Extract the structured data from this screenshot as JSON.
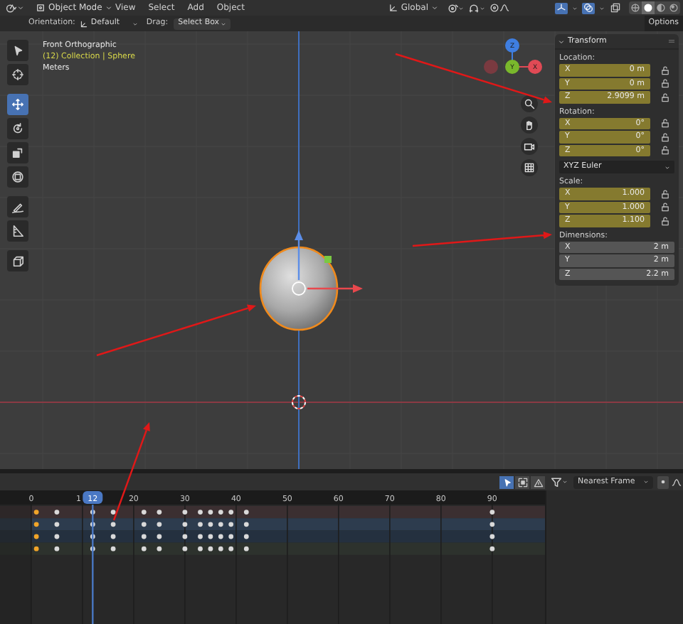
{
  "header": {
    "mode": "Object Mode",
    "menus": [
      "View",
      "Select",
      "Add",
      "Object"
    ],
    "orientation": "Global",
    "toggles": [
      {
        "kind": "gizmo",
        "on": true
      },
      {
        "kind": "overlay",
        "on": true
      },
      {
        "kind": "xray",
        "on": false
      }
    ],
    "shading": [
      {
        "kind": "wireframe",
        "selected": false
      },
      {
        "kind": "solid",
        "selected": true
      },
      {
        "kind": "material",
        "selected": false
      },
      {
        "kind": "rendered",
        "selected": false
      }
    ]
  },
  "tool_settings": {
    "orientation_label": "Orientation:",
    "orientation": "Default",
    "drag_label": "Drag:",
    "drag": "Select Box",
    "options": "Options"
  },
  "toolbar": [
    {
      "kind": "select",
      "selected": false
    },
    {
      "kind": "cursor",
      "selected": false
    },
    {
      "kind": "move",
      "selected": true
    },
    {
      "kind": "rotate",
      "selected": false
    },
    {
      "kind": "scale",
      "selected": false
    },
    {
      "kind": "transform",
      "selected": false
    },
    {
      "kind": "annotate",
      "selected": false
    },
    {
      "kind": "measure",
      "selected": false
    },
    {
      "kind": "add_cube",
      "selected": false
    }
  ],
  "view_info": [
    {
      "kind": "title",
      "text": "Front Orthographic"
    },
    {
      "kind": "context",
      "text": "(12) Collection | Sphere"
    },
    {
      "kind": "units",
      "text": "Meters"
    }
  ],
  "gizmo_axes": [
    {
      "kind": "z",
      "label": "Z"
    },
    {
      "kind": "neg_x"
    },
    {
      "kind": "y",
      "label": "Y"
    },
    {
      "kind": "x",
      "label": "X"
    }
  ],
  "nav_buttons": [
    {
      "kind": "zoom"
    },
    {
      "kind": "pan"
    },
    {
      "kind": "camera"
    },
    {
      "kind": "ortho"
    }
  ],
  "transform_panel": {
    "title": "Transform",
    "expanded": true,
    "sections": [
      {
        "kind": "fields",
        "label": "Location:",
        "fields": [
          {
            "axis": "X",
            "value": "0 m",
            "keyed": true
          },
          {
            "axis": "Y",
            "value": "0 m",
            "keyed": true
          },
          {
            "axis": "Z",
            "value": "2.9099 m",
            "keyed": true
          }
        ]
      },
      {
        "kind": "fields",
        "label": "Rotation:",
        "fields": [
          {
            "axis": "X",
            "value": "0°",
            "keyed": true
          },
          {
            "axis": "Y",
            "value": "0°",
            "keyed": true
          },
          {
            "axis": "Z",
            "value": "0°",
            "keyed": true
          }
        ]
      },
      {
        "kind": "dropdown",
        "value": "XYZ Euler"
      },
      {
        "kind": "fields",
        "label": "Scale:",
        "fields": [
          {
            "axis": "X",
            "value": "1.000",
            "keyed": true
          },
          {
            "axis": "Y",
            "value": "1.000",
            "keyed": true
          },
          {
            "axis": "Z",
            "value": "1.100",
            "keyed": true
          }
        ]
      },
      {
        "kind": "fields",
        "label": "Dimensions:",
        "fields": [
          {
            "axis": "X",
            "value": "2 m",
            "keyed": false
          },
          {
            "axis": "Y",
            "value": "2 m",
            "keyed": false
          },
          {
            "axis": "Z",
            "value": "2.2 m",
            "keyed": false
          }
        ]
      }
    ]
  },
  "timeline": {
    "tools": [
      {
        "kind": "select",
        "selected": true
      },
      {
        "kind": "box",
        "selected": false
      },
      {
        "kind": "ripple",
        "selected": false
      }
    ],
    "snap": "Nearest Frame",
    "ruler_labels": [
      "0",
      "1",
      "20",
      "30",
      "40",
      "50",
      "60",
      "70",
      "80",
      "90"
    ],
    "current_frame": "12",
    "rows": [
      {
        "color": "#3b2f31",
        "keys": [
          {
            "selected": true
          },
          {
            "selected": false
          },
          {
            "selected": false
          },
          {
            "selected": false
          },
          {
            "selected": false
          },
          {
            "selected": false
          },
          {
            "selected": false
          },
          {
            "selected": false
          },
          {
            "selected": false
          },
          {
            "selected": false
          },
          {
            "selected": false
          },
          {
            "selected": false
          },
          {
            "selected": false
          }
        ]
      },
      {
        "color": "#2d3c4e",
        "keys": [
          {
            "selected": true
          },
          {
            "selected": false
          },
          {
            "selected": false
          },
          {
            "selected": false
          },
          {
            "selected": false
          },
          {
            "selected": false
          },
          {
            "selected": false
          },
          {
            "selected": false
          },
          {
            "selected": false
          },
          {
            "selected": false
          },
          {
            "selected": false
          },
          {
            "selected": false
          },
          {
            "selected": false
          }
        ]
      },
      {
        "color": "#24303f",
        "keys": [
          {
            "selected": true
          },
          {
            "selected": false
          },
          {
            "selected": false
          },
          {
            "selected": false
          },
          {
            "selected": false
          },
          {
            "selected": false
          },
          {
            "selected": false
          },
          {
            "selected": false
          },
          {
            "selected": false
          },
          {
            "selected": false
          },
          {
            "selected": false
          },
          {
            "selected": false
          },
          {
            "selected": false
          }
        ]
      },
      {
        "color": "#2d322d",
        "keys": [
          {
            "selected": true
          },
          {
            "selected": false
          },
          {
            "selected": false
          },
          {
            "selected": false
          },
          {
            "selected": false
          },
          {
            "selected": false
          },
          {
            "selected": false
          },
          {
            "selected": false
          },
          {
            "selected": false
          },
          {
            "selected": false
          },
          {
            "selected": false
          },
          {
            "selected": false
          },
          {
            "selected": false
          }
        ]
      }
    ]
  }
}
